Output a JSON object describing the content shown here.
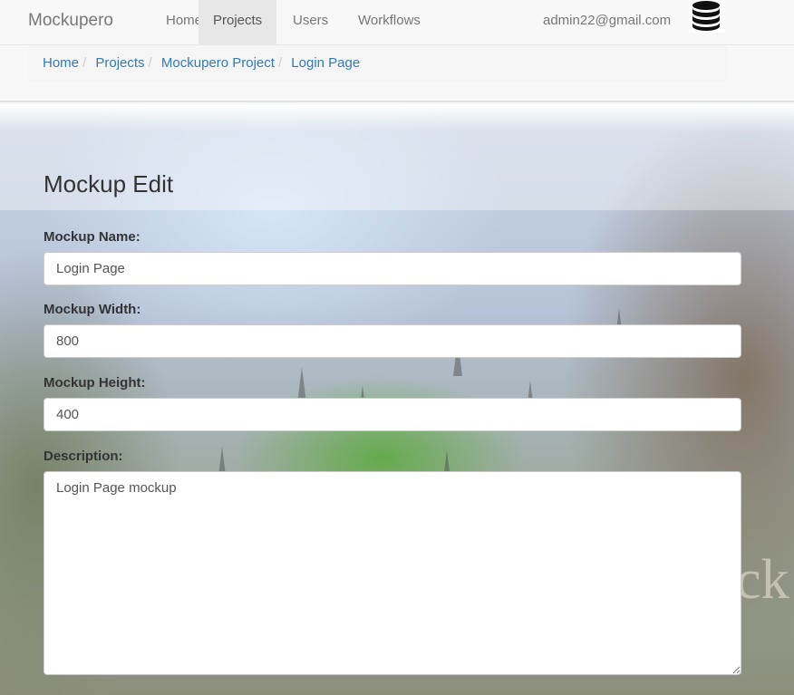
{
  "navbar": {
    "brand": "Mockupero",
    "items": [
      {
        "label": "Home"
      },
      {
        "label": "Projects",
        "active": true
      },
      {
        "label": "Users"
      },
      {
        "label": "Workflows"
      }
    ],
    "user_email": "admin22@gmail.com",
    "user_icon": "database-icon"
  },
  "breadcrumb": [
    "Home",
    "Projects",
    "Mockupero Project",
    "Login Page"
  ],
  "form": {
    "title": "Mockup Edit",
    "name_label": "Mockup Name:",
    "name_value": "Login Page",
    "width_label": "Mockup Width:",
    "width_value": "800",
    "height_label": "Mockup Height:",
    "height_value": "400",
    "description_label": "Description:",
    "description_value": "Login Page mockup"
  },
  "colors": {
    "link": "#337ab7",
    "navbar_bg": "#f8f8f8",
    "active_tab_bg": "#e7e7e7"
  }
}
